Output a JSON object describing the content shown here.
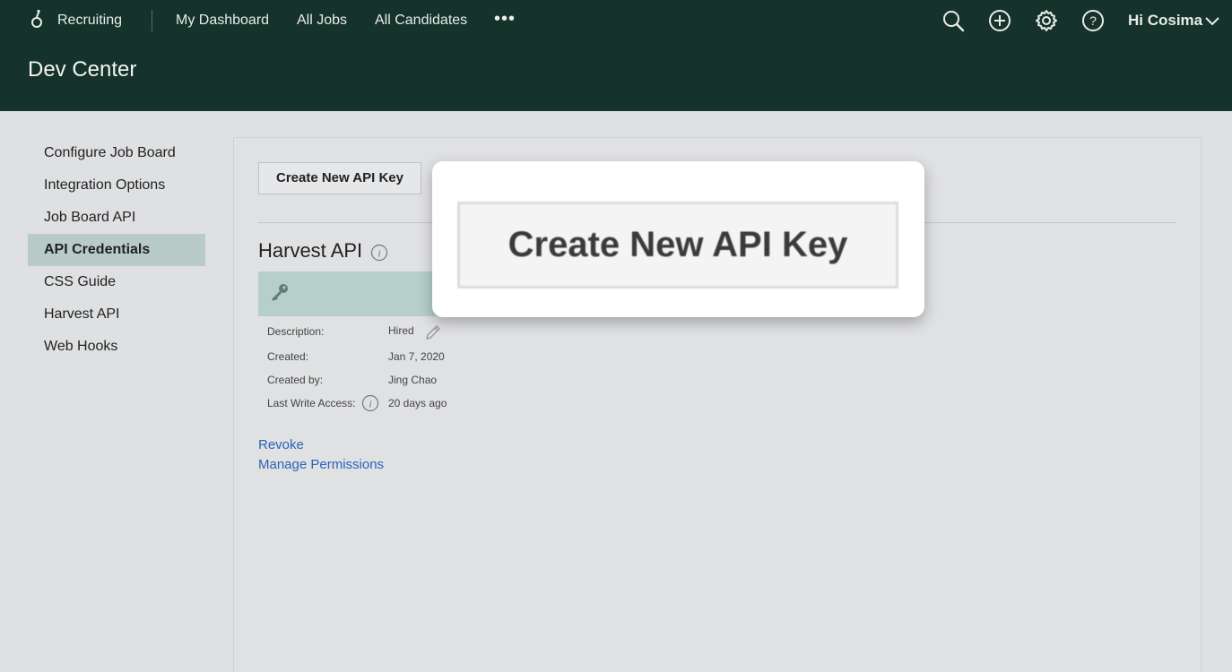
{
  "header": {
    "brand": "Recruiting",
    "nav": [
      "My Dashboard",
      "All Jobs",
      "All Candidates"
    ],
    "more": "•••",
    "greeting": "Hi Cosima",
    "page_title": "Dev Center",
    "icons": [
      "search-icon",
      "add-icon",
      "gear-icon",
      "help-icon",
      "chevron-down-icon"
    ],
    "colors": {
      "bg": "#15322b"
    }
  },
  "sidebar": {
    "items": [
      "Configure Job Board",
      "Integration Options",
      "Job Board API",
      "API Credentials",
      "CSS Guide",
      "Harvest API",
      "Web Hooks"
    ],
    "active": "API Credentials",
    "colors": {
      "active_bg": "#b9cbc8"
    }
  },
  "main": {
    "create_button": "Create New API Key",
    "section_title": "Harvest API",
    "credential": {
      "description_label": "Description:",
      "description_value": "Hired",
      "created_label": "Created:",
      "created_value": "Jan 7, 2020",
      "created_by_label": "Created by:",
      "created_by_value": "Jing Chao",
      "last_write_label": "Last Write Access:",
      "last_write_value": "20 days ago"
    },
    "links": {
      "revoke": "Revoke",
      "manage": "Manage Permissions"
    },
    "colors": {
      "key_bar": "#b6cfcb",
      "link": "#2a63b8"
    }
  },
  "callout": {
    "button_label": "Create New API Key"
  }
}
